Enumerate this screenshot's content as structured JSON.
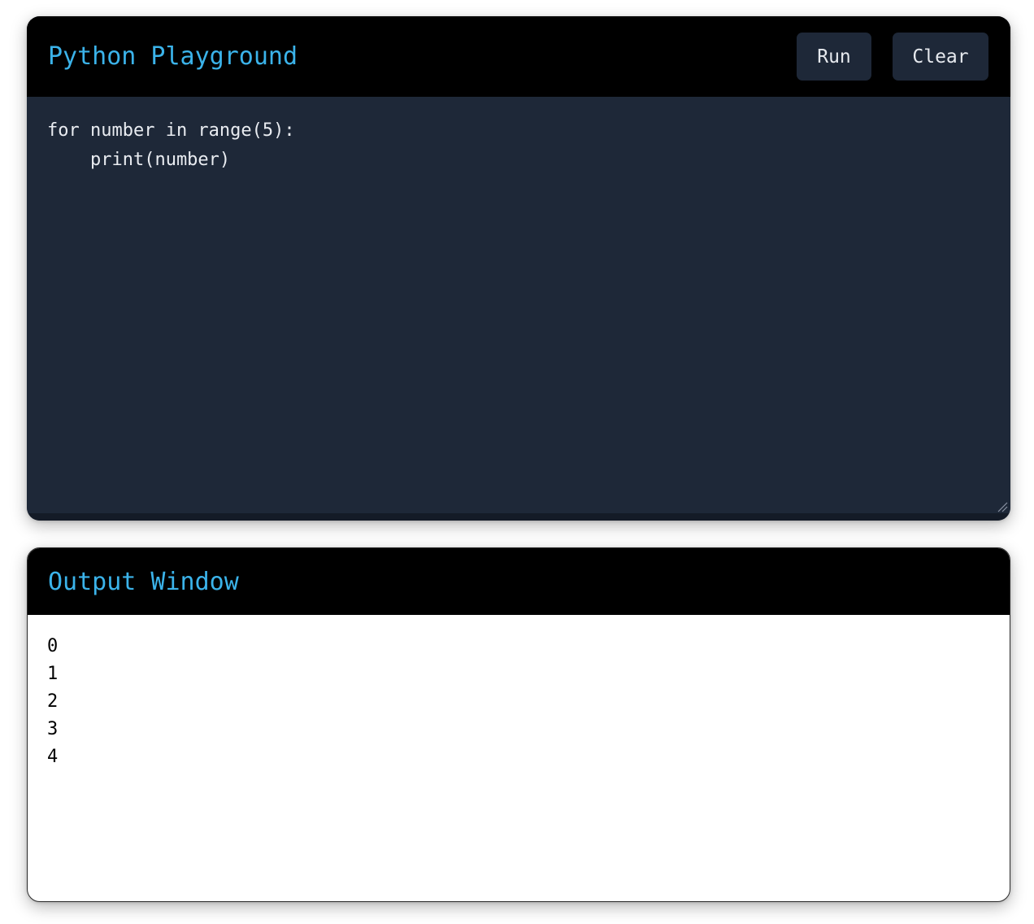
{
  "editor": {
    "title": "Python Playground",
    "run_label": "Run",
    "clear_label": "Clear",
    "code": "for number in range(5):\n    print(number)"
  },
  "output": {
    "title": "Output Window",
    "lines": [
      "0",
      "1",
      "2",
      "3",
      "4"
    ]
  },
  "colors": {
    "title_accent": "#3bb3ea",
    "header_bg": "#000000",
    "editor_bg": "#1e2838",
    "button_bg": "#1e2838",
    "output_bg": "#ffffff"
  }
}
